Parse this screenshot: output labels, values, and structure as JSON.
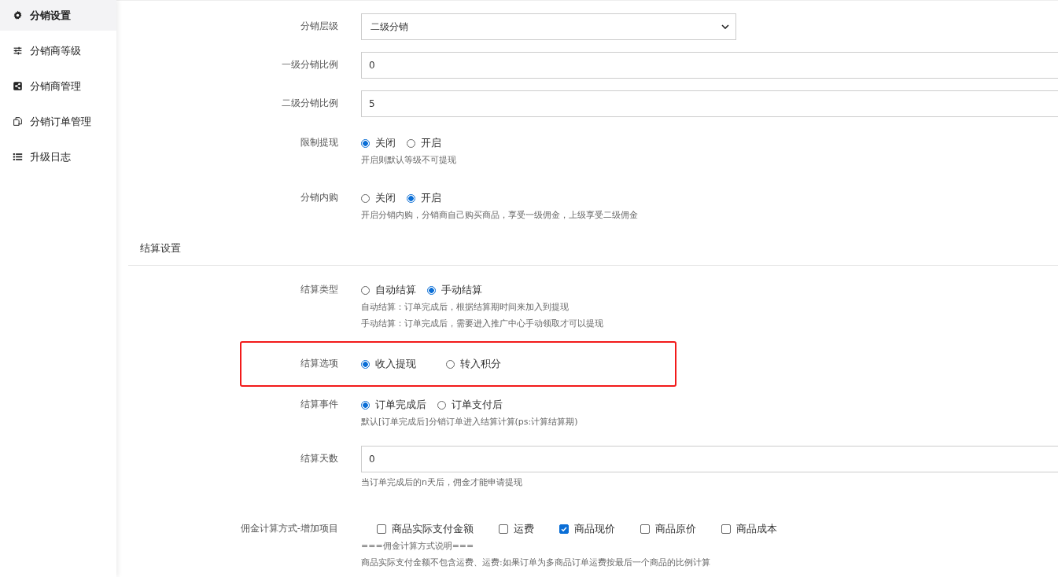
{
  "sidebar": {
    "items": [
      {
        "label": "分销设置",
        "selected": true
      },
      {
        "label": "分销商等级",
        "selected": false
      },
      {
        "label": "分销商管理",
        "selected": false
      },
      {
        "label": "分销订单管理",
        "selected": false
      },
      {
        "label": "升级日志",
        "selected": false
      }
    ]
  },
  "form": {
    "rows": [
      {
        "kind": "select",
        "label": "分销层级",
        "value": "二级分销"
      },
      {
        "kind": "input",
        "label": "一级分销比例",
        "value": "0"
      },
      {
        "kind": "input",
        "label": "二级分销比例",
        "value": "5"
      },
      {
        "kind": "radio",
        "label": "限制提现",
        "options": [
          {
            "label": "关闭",
            "selected": true
          },
          {
            "label": "开启",
            "selected": false
          }
        ],
        "hints": [
          "开启则默认等级不可提现"
        ]
      },
      {
        "kind": "radio",
        "label": "分销内购",
        "options": [
          {
            "label": "关闭",
            "selected": false
          },
          {
            "label": "开启",
            "selected": true
          }
        ],
        "hints": [
          "开启分销内购，分销商自己购买商品，享受一级佣金，上级享受二级佣金"
        ]
      },
      {
        "kind": "section",
        "label": "结算设置"
      },
      {
        "kind": "radio",
        "label": "结算类型",
        "options": [
          {
            "label": "自动结算",
            "selected": false
          },
          {
            "label": "手动结算",
            "selected": true
          }
        ],
        "hints": [
          "自动结算：订单完成后，根据结算期时间来加入到提现",
          "手动结算：订单完成后，需要进入推广中心手动领取才可以提现"
        ]
      },
      {
        "kind": "radio",
        "label": "结算选项",
        "highlighted": true,
        "options": [
          {
            "label": "收入提现",
            "selected": true
          },
          {
            "label": "转入积分",
            "selected": false
          }
        ]
      },
      {
        "kind": "radio",
        "label": "结算事件",
        "options": [
          {
            "label": "订单完成后",
            "selected": true
          },
          {
            "label": "订单支付后",
            "selected": false
          }
        ],
        "hints": [
          "默认[订单完成后]分销订单进入结算计算(ps:计算结算期)"
        ]
      },
      {
        "kind": "input",
        "label": "结算天数",
        "value": "0",
        "hints": [
          "当订单完成后的n天后，佣金才能申请提现"
        ]
      },
      {
        "kind": "checkbox",
        "label": "佣金计算方式-增加项目",
        "options": [
          {
            "label": "商品实际支付金额",
            "checked": false
          },
          {
            "label": "运费",
            "checked": false
          },
          {
            "label": "商品现价",
            "checked": true
          },
          {
            "label": "商品原价",
            "checked": false
          },
          {
            "label": "商品成本",
            "checked": false
          }
        ],
        "hints": [
          "===佣金计算方式说明===",
          "商品实际支付金额不包含运费、运费:如果订单为多商品订单运费按最后一个商品的比例计算"
        ]
      }
    ]
  }
}
